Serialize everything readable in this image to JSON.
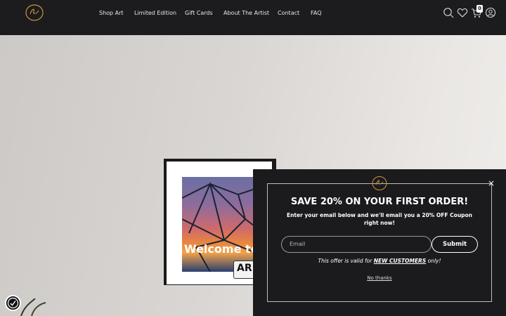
{
  "header": {
    "logo_alt": "Artist signature logo",
    "nav": [
      "Shop Art",
      "Limited Edition",
      "Gift Cards",
      "About The Artist",
      "Contact",
      "FAQ"
    ],
    "cart_count": "0",
    "icons": [
      "search-icon",
      "heart-icon",
      "cart-icon",
      "account-icon"
    ]
  },
  "hero": {
    "welcome_text": "Welcome to",
    "art_badge_text": "AR"
  },
  "popup": {
    "title": "SAVE 20% ON YOUR FIRST ORDER!",
    "subtitle": "Enter your email below and we'll email you a 20% OFF Coupon right now!",
    "email_placeholder": "Email",
    "submit_label": "Submit",
    "offer_prefix": "This offer is valid for ",
    "offer_emphasis": "NEW CUSTOMERS",
    "offer_suffix": " only!",
    "no_thanks": "No thanks",
    "close_label": "×"
  },
  "colors": {
    "header_bg": "#1c1c1e",
    "popup_bg": "#1b1b1d",
    "logo_gold": "#c9963a"
  }
}
